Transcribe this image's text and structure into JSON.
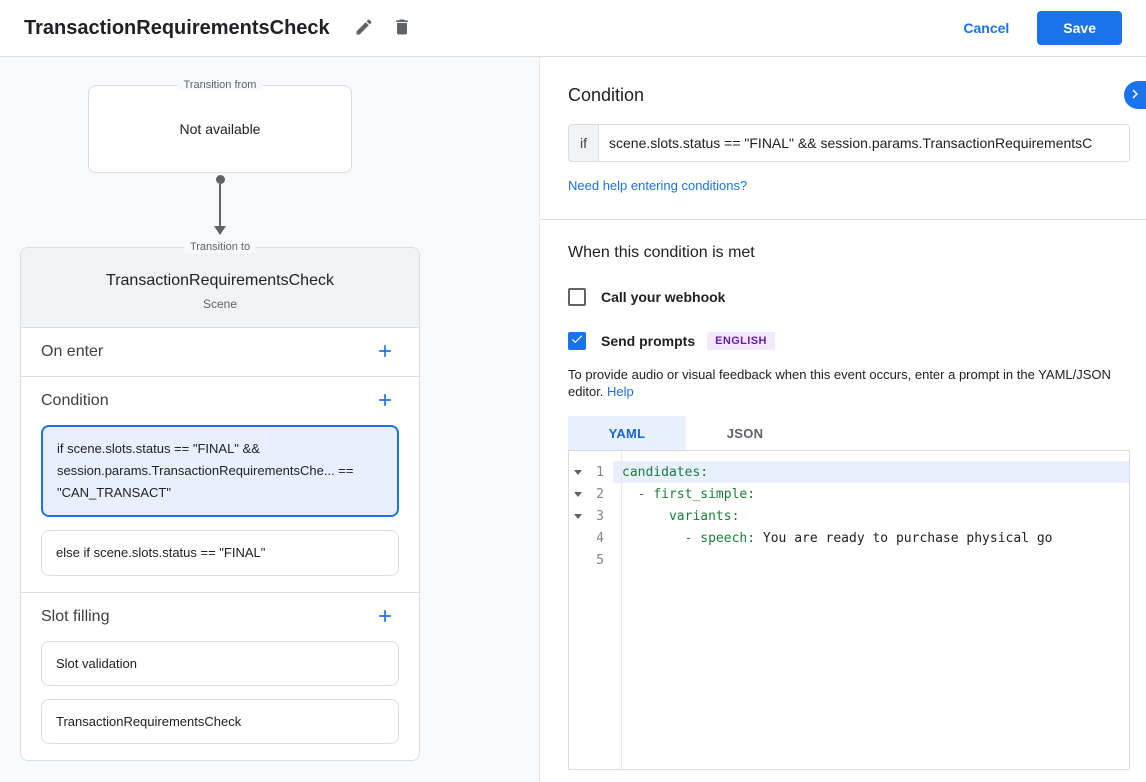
{
  "colors": {
    "accent": "#1a73e8",
    "selected_condition_bg": "#e8f0fe",
    "yaml_key_green": "#188038",
    "language_badge_bg": "#f3e8fd",
    "language_badge_text": "#681da8"
  },
  "header": {
    "title": "TransactionRequirementsCheck",
    "cancel_label": "Cancel",
    "save_label": "Save"
  },
  "canvas": {
    "transition_from": {
      "label": "Transition from",
      "value": "Not available"
    },
    "transition_to": {
      "label": "Transition to",
      "title": "TransactionRequirementsCheck",
      "subtitle": "Scene",
      "sections": {
        "on_enter": {
          "label": "On enter"
        },
        "condition": {
          "label": "Condition",
          "items": [
            {
              "text": "if scene.slots.status == \"FINAL\" && session.params.TransactionRequirementsChe... == \"CAN_TRANSACT\"",
              "selected": true
            },
            {
              "text": "else if scene.slots.status == \"FINAL\"",
              "selected": false
            }
          ]
        },
        "slot_filling": {
          "label": "Slot filling",
          "items": [
            {
              "text": "Slot validation"
            },
            {
              "text": "TransactionRequirementsCheck"
            }
          ]
        }
      }
    }
  },
  "detail": {
    "title": "Condition",
    "if_label": "if",
    "condition_value": "scene.slots.status == \"FINAL\" && session.params.TransactionRequirementsC",
    "help_link": "Need help entering conditions?",
    "when_met_title": "When this condition is met",
    "webhook_label": "Call your webhook",
    "send_prompts_label": "Send prompts",
    "language_badge": "ENGLISH",
    "prompt_hint": "To provide audio or visual feedback when this event occurs, enter a prompt in the YAML/JSON editor.",
    "help_label": "Help",
    "tabs": [
      {
        "label": "YAML",
        "active": true
      },
      {
        "label": "JSON",
        "active": false
      }
    ],
    "editor": {
      "lines": [
        {
          "num": "1",
          "prefix": "",
          "key": "candidates",
          "sep": ":",
          "value": ""
        },
        {
          "num": "2",
          "prefix": "  - ",
          "key": "first_simple",
          "sep": ":",
          "value": ""
        },
        {
          "num": "3",
          "prefix": "      ",
          "key": "variants",
          "sep": ":",
          "value": ""
        },
        {
          "num": "4",
          "prefix": "        - ",
          "key": "speech",
          "sep": ": ",
          "value": "You are ready to purchase physical go"
        },
        {
          "num": "5",
          "prefix": "",
          "key": "",
          "sep": "",
          "value": ""
        }
      ]
    }
  }
}
